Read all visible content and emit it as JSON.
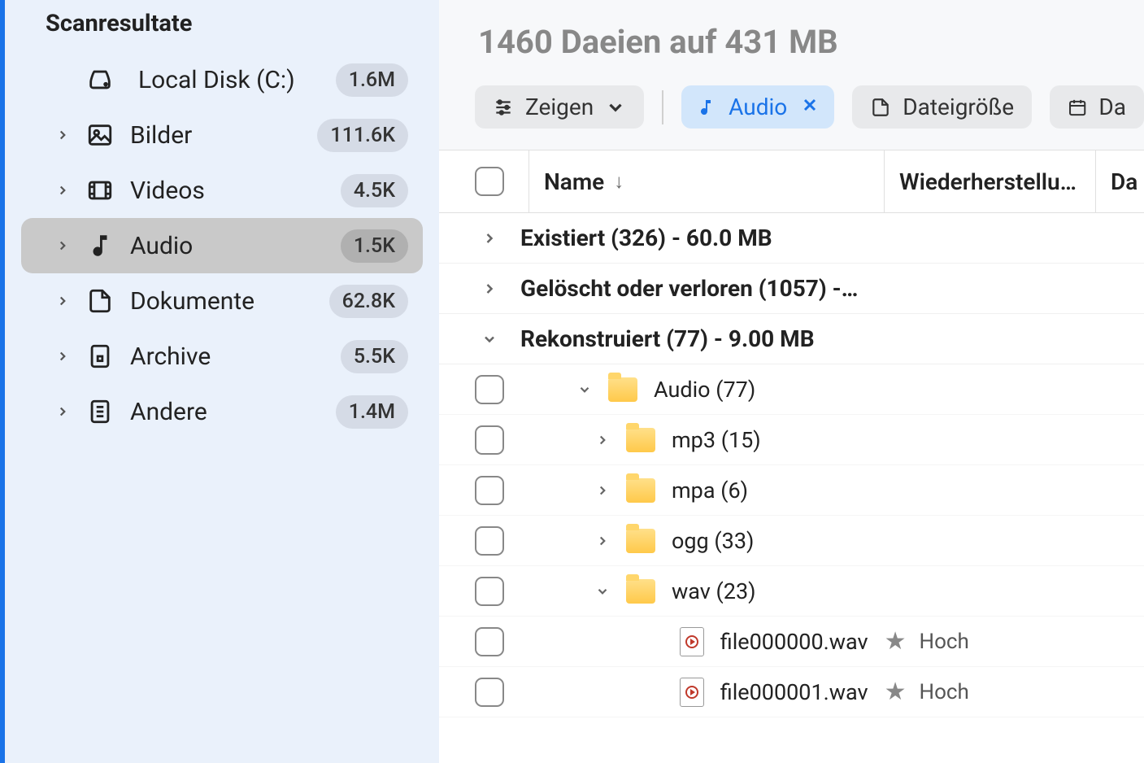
{
  "sidebar": {
    "title": "Scanresultate",
    "items": [
      {
        "label": "Local Disk (C:)",
        "badge": "1.6M",
        "icon": "disk"
      },
      {
        "label": "Bilder",
        "badge": "111.6K",
        "icon": "image"
      },
      {
        "label": "Videos",
        "badge": "4.5K",
        "icon": "video"
      },
      {
        "label": "Audio",
        "badge": "1.5K",
        "icon": "audio"
      },
      {
        "label": "Dokumente",
        "badge": "62.8K",
        "icon": "document"
      },
      {
        "label": "Archive",
        "badge": "5.5K",
        "icon": "archive"
      },
      {
        "label": "Andere",
        "badge": "1.4M",
        "icon": "other"
      }
    ]
  },
  "header": {
    "title": "1460 Daeien auf 431 MB"
  },
  "toolbar": {
    "show_label": "Zeigen",
    "filter_label": "Audio",
    "filesize_label": "Dateigröße",
    "date_label": "Da"
  },
  "table": {
    "col_name": "Name",
    "col_recovery": "Wiederherstellu…",
    "col_date": "Da"
  },
  "groups": [
    {
      "label": "Existiert (326) - 60.0 MB",
      "expanded": false
    },
    {
      "label": "Gelöscht oder verloren (1057) -…",
      "expanded": false
    },
    {
      "label": "Rekonstruiert (77) - 9.00 MB",
      "expanded": true
    }
  ],
  "folders": {
    "root": {
      "label": "Audio (77)",
      "expanded": true
    },
    "subs": [
      {
        "label": "mp3 (15)",
        "expanded": false
      },
      {
        "label": "mpa (6)",
        "expanded": false
      },
      {
        "label": "ogg (33)",
        "expanded": false
      },
      {
        "label": "wav (23)",
        "expanded": true
      }
    ]
  },
  "files": [
    {
      "name": "file000000.wav",
      "recovery": "Hoch"
    },
    {
      "name": "file000001.wav",
      "recovery": "Hoch"
    }
  ]
}
